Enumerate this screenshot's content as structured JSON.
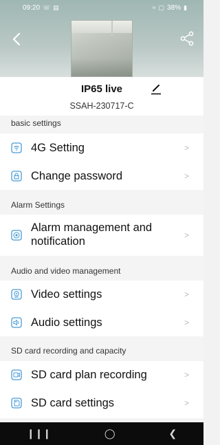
{
  "status_bar": {
    "time": "09:20",
    "battery": "38%",
    "left_icons": [
      "call-icon",
      "message-icon"
    ],
    "right_icons": [
      "wifi-icon",
      "signal-icon"
    ]
  },
  "camera": {
    "name": "IP65 live",
    "serial": "SSAH-230717-C"
  },
  "sections": [
    {
      "title": "basic settings",
      "items": [
        {
          "label": "4G Setting",
          "icon": "4g-icon"
        },
        {
          "label": "Change password",
          "icon": "lock-icon"
        }
      ]
    },
    {
      "title": "Alarm Settings",
      "items": [
        {
          "label": "Alarm management and notification",
          "icon": "alarm-icon"
        }
      ]
    },
    {
      "title": "Audio and video management",
      "items": [
        {
          "label": "Video settings",
          "icon": "webcam-icon"
        },
        {
          "label": "Audio settings",
          "icon": "speaker-icon"
        }
      ]
    },
    {
      "title": "SD card recording and capacity",
      "items": [
        {
          "label": "SD card plan recording",
          "icon": "sd-record-icon"
        },
        {
          "label": "SD card settings",
          "icon": "sd-card-icon"
        }
      ]
    }
  ],
  "colors": {
    "accent": "#4a9bd6",
    "header": "#a9bdb9",
    "nav_bar": "#0c0c0c"
  }
}
